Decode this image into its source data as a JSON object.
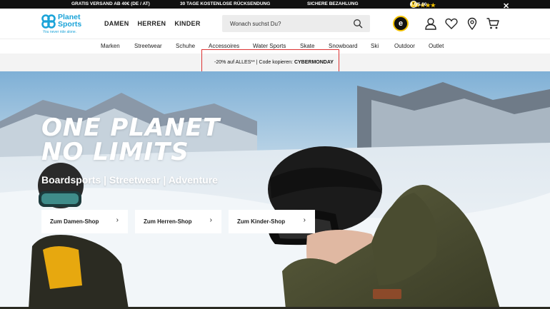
{
  "topbar": {
    "shipping": "GRATIS VERSAND AB 40€ (DE / AT)",
    "returns": "30 TAGE KOSTENLOSE RÜCKSENDUNG",
    "payment": "SICHERE BEZAHLUNG",
    "rating_stars": "★★★★★",
    "rating_score": "4.6/5.00",
    "close": "✕"
  },
  "header": {
    "logo_line1": "Planet",
    "logo_line2": "Sports",
    "logo_tagline": "You never ride alone.",
    "gender_nav": [
      "DAMEN",
      "HERREN",
      "KINDER"
    ],
    "search_placeholder": "Wonach suchst Du?",
    "trusted_badge": "e"
  },
  "catnav": [
    "Marken",
    "Streetwear",
    "Schuhe",
    "Accessoires",
    "Water Sports",
    "Skate",
    "Snowboard",
    "Ski",
    "Outdoor",
    "Outlet"
  ],
  "promo": {
    "text": "-20% auf ALLES** | Code kopieren: ",
    "code": "CYBERMONDAY"
  },
  "hero": {
    "headline_line1": "ONE PLANET",
    "headline_line2": "NO LIMITS",
    "subline": "Boardsports | Streetwear | Adventure",
    "ctas": [
      "Zum Damen-Shop",
      "Zum Herren-Shop",
      "Zum Kinder-Shop"
    ],
    "chevron": "›"
  },
  "colors": {
    "brand": "#1aa3d8",
    "topbar_bg": "#111111",
    "promo_highlight": "#dd3333",
    "star": "#f3c200"
  }
}
